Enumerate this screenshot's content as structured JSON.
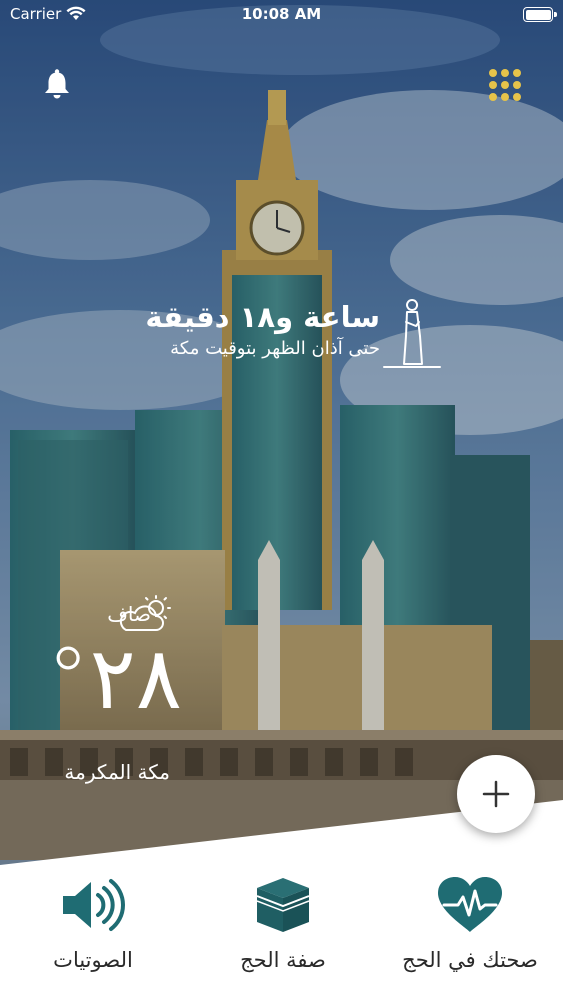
{
  "status_bar": {
    "carrier": "Carrier",
    "time": "10:08 AM",
    "battery_level": 1.0
  },
  "header": {
    "notifications_icon": "bell-icon",
    "menu_icon": "grid-menu-icon"
  },
  "prayer": {
    "countdown": "ساعة و١٨ دقيقة",
    "caption": "حتى آذان الظهر بتوقيت مكة",
    "icon": "praying-man-icon"
  },
  "weather": {
    "condition": "صاف",
    "icon": "partly-cloudy-icon",
    "temperature": "٢٨°",
    "city": "مكة المكرمة"
  },
  "fab": {
    "icon": "plus-icon"
  },
  "bottom_nav": [
    {
      "label": "صحتك في الحج",
      "icon": "heart-pulse-icon"
    },
    {
      "label": "صفة الحج",
      "icon": "kaaba-icon"
    },
    {
      "label": "الصوتيات",
      "icon": "speaker-icon"
    }
  ],
  "colors": {
    "accent": "#1f6c73",
    "gold": "#e6c34a",
    "background_sheet": "#ffffff"
  }
}
